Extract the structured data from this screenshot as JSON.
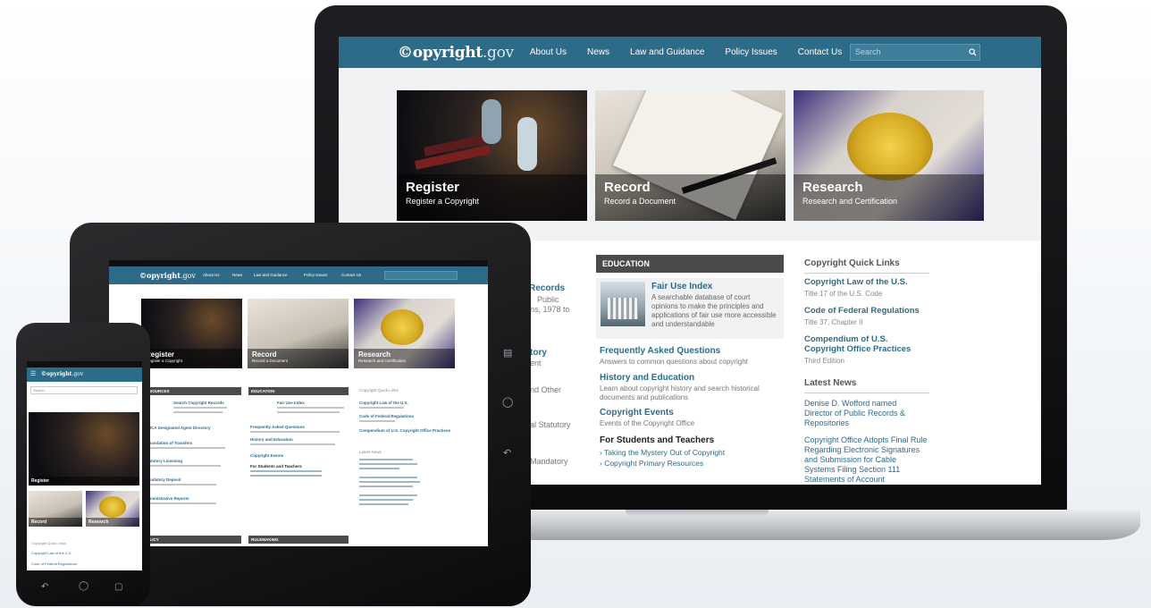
{
  "site": {
    "logo_main": "©opyright",
    "logo_gov": ".gov",
    "nav": [
      "About Us",
      "News",
      "Law and Guidance",
      "Policy Issues",
      "Contact Us"
    ],
    "search_placeholder": "Search",
    "search_icon": "magnifier-icon"
  },
  "hero": [
    {
      "title": "Register",
      "subtitle": "Register a Copyright"
    },
    {
      "title": "Record",
      "subtitle": "Record a Document"
    },
    {
      "title": "Research",
      "subtitle": "Research and Certification"
    }
  ],
  "left_column_fragments": {
    "heading_frag": "Records",
    "line1": "Public",
    "line2": "ns, 1978 to",
    "tory": "tory",
    "ent": "ent",
    "and_other": "nd Other",
    "statutory": "al Statutory",
    "mandatory": "Mandatory"
  },
  "education": {
    "header": "EDUCATION",
    "feature_title": "Fair Use Index",
    "feature_desc": "A searchable database of court opinions to make the principles and applications of fair use more accessible and understandable",
    "links": [
      {
        "title": "Frequently Asked Questions",
        "desc": "Answers to common questions about copyright"
      },
      {
        "title": "History and Education",
        "desc": "Learn about copyright history and search historical documents and publications"
      },
      {
        "title": "Copyright Events",
        "desc": "Events of the Copyright Office"
      }
    ],
    "students_title": "For Students and Teachers",
    "student_links": [
      "› Taking the Mystery Out of Copyright",
      "› Copyright Primary Resources"
    ]
  },
  "quick_links": {
    "header": "Copyright Quick Links",
    "items": [
      {
        "title": "Copyright Law of the U.S.",
        "sub": "Title 17 of the U.S. Code"
      },
      {
        "title": "Code of Federal Regulations",
        "sub": "Title 37, Chapter II"
      },
      {
        "title": "Compendium of U.S. Copyright Office Practices",
        "sub": "Third Edition"
      }
    ],
    "news_header": "Latest News",
    "news": [
      "Denise D. Wofford named Director of Public Records & Repositories",
      "Copyright Office Adopts Final Rule Regarding Electronic Signatures and Submission for Cable Systems Filing Section 111 Statements of Account"
    ]
  },
  "tablet": {
    "header_resources": "RESOURCES",
    "header_education": "EDUCATION",
    "header_policy": "POLICY",
    "header_rulemaking": "RULEMAKING",
    "sidebar_title": "Copyright Quick Links",
    "latest_news": "Latest News",
    "resources_items": [
      "Search Copyright Records",
      "DMCA Designated Agent Directory",
      "Recordation of Transfers",
      "Statutory Licensing",
      "Mandatory Deposit",
      "Administrative Reports"
    ],
    "education_items": [
      "Fair Use Index",
      "Frequently Asked Questions",
      "History and Education",
      "Copyright Events",
      "For Students and Teachers"
    ],
    "quick_items": [
      "Copyright Law of the U.S.",
      "Code of Federal Regulations",
      "Compendium of U.S. Copyright Office Practices"
    ]
  },
  "phone": {
    "search_placeholder": "Search",
    "tiles": [
      "Register",
      "Record",
      "Research"
    ],
    "quick_title": "Copyright Quick Links",
    "quick_items": [
      "Copyright Law of the U.S.",
      "Code of Federal Regulations"
    ]
  }
}
